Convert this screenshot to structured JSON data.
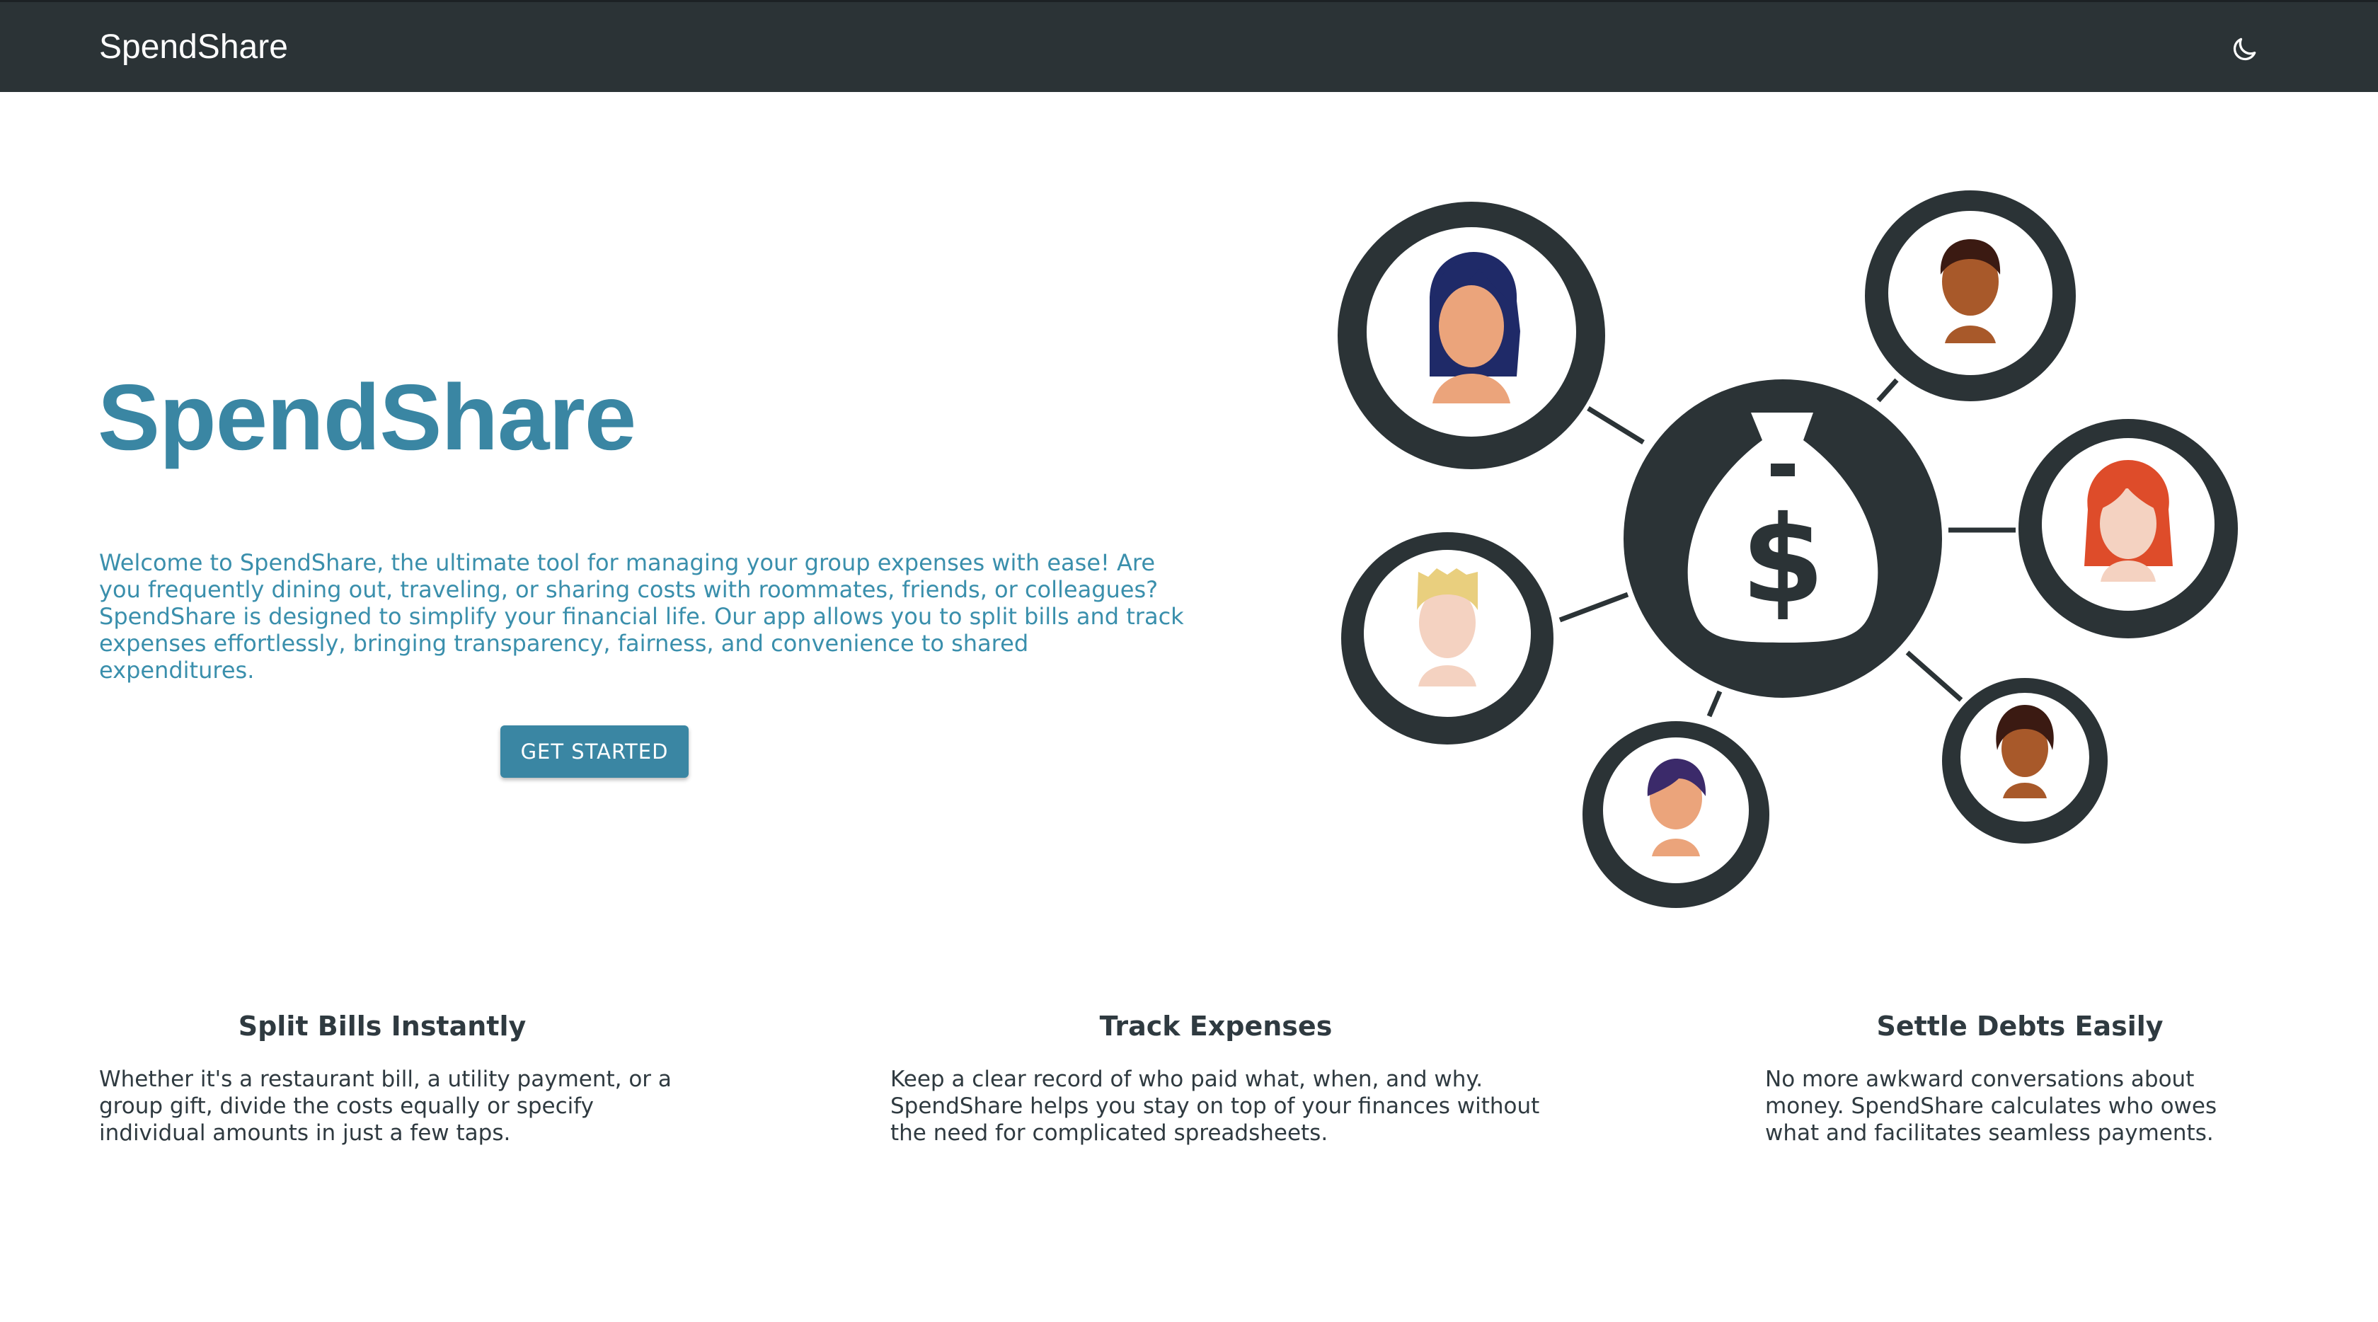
{
  "nav": {
    "brand": "SpendShare",
    "theme_toggle_icon": "moon-icon"
  },
  "hero": {
    "title": "SpendShare",
    "intro": "Welcome to SpendShare, the ultimate tool for managing your group expenses with ease! Are you frequently dining out, traveling, or sharing costs with roommates, friends, or colleagues? SpendShare is designed to simplify your financial life. Our app allows you to split bills and track expenses effortlessly, bringing transparency, fairness, and convenience to shared expenditures.",
    "cta_label": "GET STARTED",
    "illustration_icon": "money-bag-network-illustration"
  },
  "features": [
    {
      "title": "Split Bills Instantly",
      "text": "Whether it's a restaurant bill, a utility payment, or a group gift, divide the costs equally or specify individual amounts in just a few taps."
    },
    {
      "title": "Track Expenses",
      "text": "Keep a clear record of who paid what, when, and why. SpendShare helps you stay on top of your finances without the need for complicated spreadsheets."
    },
    {
      "title": "Settle Debts Easily",
      "text": "No more awkward conversations about money. SpendShare calculates who owes what and facilitates seamless payments."
    }
  ],
  "colors": {
    "navbar": "#2b3336",
    "accent": "#3a86a3",
    "text": "#2f3a40"
  }
}
